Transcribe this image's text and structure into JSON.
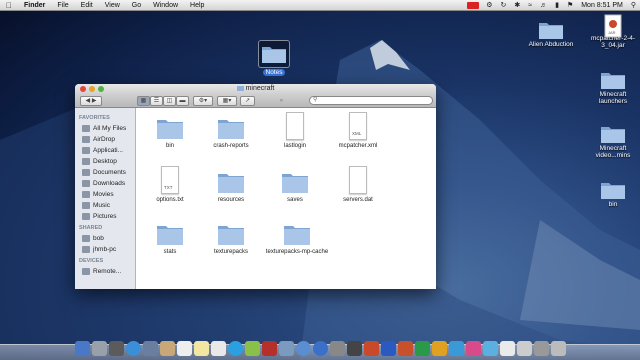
{
  "menubar": {
    "app": "Finder",
    "items": [
      "File",
      "Edit",
      "View",
      "Go",
      "Window",
      "Help"
    ],
    "clock": "Mon 8:51 PM",
    "battery_icon": "battery-icon",
    "wifi_icon": "wifi-icon"
  },
  "desktop": {
    "notes": "Notes",
    "items": [
      {
        "label": "Alien Abduction",
        "icon": "folder-icon"
      },
      {
        "label": "mcpatcher-2-4-3_04.jar",
        "icon": "jar-file-icon"
      },
      {
        "label": "Minecraft launchers",
        "icon": "folder-icon"
      },
      {
        "label": "Minecraft video...mins",
        "icon": "folder-icon"
      },
      {
        "label": "bin",
        "icon": "folder-icon"
      }
    ]
  },
  "window": {
    "title": "minecraft",
    "search_placeholder": "",
    "sidebar": {
      "favorites_header": "FAVORITES",
      "favorites": [
        "All My Files",
        "AirDrop",
        "Applicati...",
        "Desktop",
        "Documents",
        "Downloads",
        "Movies",
        "Music",
        "Pictures"
      ],
      "shared_header": "SHARED",
      "shared": [
        "bob",
        "jhmb-pc"
      ],
      "devices_header": "DEVICES",
      "devices": [
        "Remote..."
      ]
    },
    "files": [
      {
        "name": "bin",
        "type": "folder"
      },
      {
        "name": "crash-reports",
        "type": "folder"
      },
      {
        "name": "lastlogin",
        "type": "doc",
        "tag": ""
      },
      {
        "name": "mcpatcher.xml",
        "type": "doc",
        "tag": "XML"
      },
      {
        "name": "options.txt",
        "type": "doc",
        "tag": "TXT"
      },
      {
        "name": "resources",
        "type": "folder"
      },
      {
        "name": "saves",
        "type": "folder"
      },
      {
        "name": "servers.dat",
        "type": "doc",
        "tag": ""
      },
      {
        "name": "stats",
        "type": "folder"
      },
      {
        "name": "texturepacks",
        "type": "folder"
      },
      {
        "name": "texturepacks-mp-cache",
        "type": "folder"
      }
    ]
  },
  "colors": {
    "folder": "#a9c6e8",
    "folder_dark": "#7ea4d2",
    "selection": "#3875d7"
  }
}
